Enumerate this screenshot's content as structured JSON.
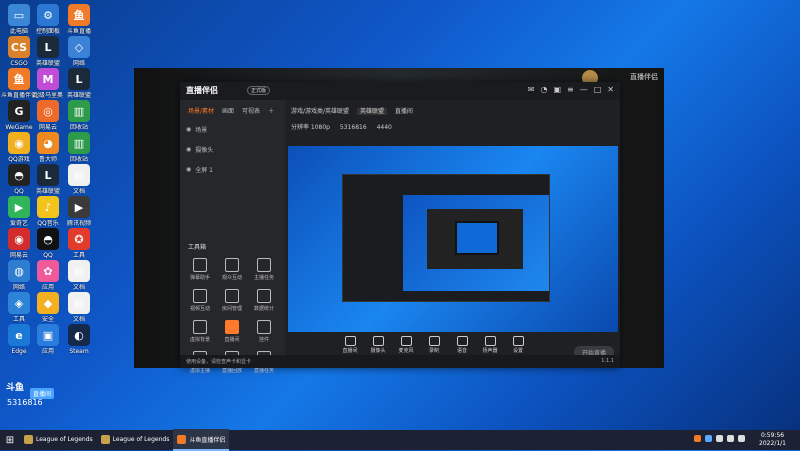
{
  "desktop_icons": [
    {
      "label": "此电脑",
      "color": "#3b87d6",
      "glyph": "▭"
    },
    {
      "label": "控制面板",
      "color": "#2a78d1",
      "glyph": "⚙"
    },
    {
      "label": "斗鱼直播",
      "color": "#f07a28",
      "glyph": "鱼"
    },
    {
      "label": "CSGO",
      "color": "#d9802b",
      "glyph": "CS"
    },
    {
      "label": "英雄联盟",
      "color": "#1a2a3a",
      "glyph": "L"
    },
    {
      "label": "网络",
      "color": "#3a82d6",
      "glyph": "◇"
    },
    {
      "label": "斗鱼直播伴侣",
      "color": "#f07a28",
      "glyph": "鱼"
    },
    {
      "label": "超级马里奥",
      "color": "#c04dd6",
      "glyph": "M"
    },
    {
      "label": "英雄联盟",
      "color": "#1a2a3a",
      "glyph": "L"
    },
    {
      "label": "WeGame",
      "color": "#222",
      "glyph": "G"
    },
    {
      "label": "网易云",
      "color": "#ee6a2a",
      "glyph": "◎"
    },
    {
      "label": "回收站",
      "color": "#2c9b4a",
      "glyph": "▥"
    },
    {
      "label": "QQ游戏",
      "color": "#f0b020",
      "glyph": "◉"
    },
    {
      "label": "鲁大师",
      "color": "#f08a20",
      "glyph": "◕"
    },
    {
      "label": "回收站",
      "color": "#2c9b4a",
      "glyph": "▥"
    },
    {
      "label": "QQ",
      "color": "#222",
      "glyph": "◓"
    },
    {
      "label": "英雄联盟",
      "color": "#1a2a3a",
      "glyph": "L"
    },
    {
      "label": "文档",
      "color": "#f1f1f1",
      "glyph": "▤"
    },
    {
      "label": "爱奇艺",
      "color": "#30b55a",
      "glyph": "▶"
    },
    {
      "label": "QQ音乐",
      "color": "#f2c31a",
      "glyph": "♪"
    },
    {
      "label": "腾讯视频",
      "color": "#3a3a3a",
      "glyph": "▶"
    },
    {
      "label": "网易云",
      "color": "#d22c2c",
      "glyph": "◉"
    },
    {
      "label": "QQ",
      "color": "#111",
      "glyph": "◓"
    },
    {
      "label": "工具",
      "color": "#e23b2c",
      "glyph": "✪"
    },
    {
      "label": "网络",
      "color": "#2f7dd0",
      "glyph": "◍"
    },
    {
      "label": "应用",
      "color": "#f05a9a",
      "glyph": "✿"
    },
    {
      "label": "文档",
      "color": "#f1f1f1",
      "glyph": "▤"
    },
    {
      "label": "工具",
      "color": "#2c83d8",
      "glyph": "◈"
    },
    {
      "label": "安全",
      "color": "#f4b020",
      "glyph": "◆"
    },
    {
      "label": "文档",
      "color": "#f1f1f1",
      "glyph": "▤"
    },
    {
      "label": "Edge",
      "color": "#1a78d6",
      "glyph": "e"
    },
    {
      "label": "应用",
      "color": "#2b7ddd",
      "glyph": "▣"
    },
    {
      "label": "Steam",
      "color": "#15294a",
      "glyph": "◐"
    }
  ],
  "background_window": {
    "title": "直播伴侣"
  },
  "app": {
    "logo": "直播伴侣",
    "version": "正式版",
    "tabs": [
      "场景/素材",
      "画面",
      "可视表"
    ],
    "scenes": [
      "场景",
      "摄像头",
      "全屏 1"
    ],
    "category_label": "游戏/游戏类/英雄联盟",
    "category_tag": "英雄联盟",
    "sub_label": "直播间",
    "resolution": "分辨率 1080p",
    "stats_1": "5316816",
    "stats_2": "4440",
    "tools_title": "工具箱",
    "tools": [
      "弹幕助手",
      "观众互动",
      "主播任务",
      "视频互动",
      "房间管理",
      "数据统计",
      "虚拟背景",
      "直播间",
      "挂件",
      "虚拟主播",
      "直播回放",
      "直播任务"
    ],
    "bottom_tools": [
      "直播间",
      "摄像头",
      "麦克风",
      "录制",
      "语音",
      "扬声器",
      "设置"
    ],
    "start_label": "开始直播",
    "status_left": "使用设备，请检查声卡和显卡",
    "status_right": "1.1.1"
  },
  "taskbar": {
    "items": [
      {
        "label": "League of Legends",
        "color": "#c8a24a"
      },
      {
        "label": "League of Legends",
        "color": "#c8a24a"
      },
      {
        "label": "斗鱼直播伴侣",
        "color": "#f07a28"
      }
    ],
    "time": "0:59:56",
    "date": "2022/1/1"
  },
  "overlay": {
    "logo": "斗鱼",
    "badge": "直播间",
    "room": "5316816"
  }
}
